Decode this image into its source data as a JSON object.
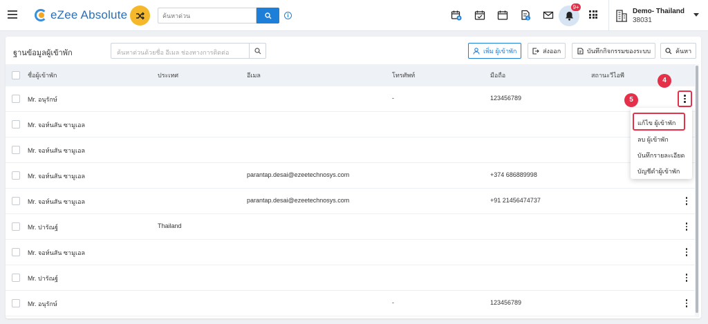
{
  "header": {
    "app_name": "eZee Absolute",
    "search_placeholder": "ค้นหาด่วน",
    "notifications_count": "9+",
    "property": {
      "name": "Demo- Thailand",
      "code": "38031"
    },
    "icons": [
      "menu-icon",
      "shuffle-icon",
      "search-icon",
      "info-icon",
      "calendar-plus-icon",
      "calendar-check-icon",
      "calendar-icon",
      "document-badge-icon",
      "mail-icon",
      "bell-icon",
      "apps-grid-icon",
      "building-icon",
      "chevron-down-icon"
    ]
  },
  "card": {
    "title": "ฐานข้อมูลผู้เข้าพัก",
    "search_placeholder": "ค้นหาด่วนด้วยชื่อ อีเมล ช่องทางการติดต่อ",
    "buttons": {
      "add_guest": "เพิ่ม ผู้เข้าพัก",
      "export": "ส่งออก",
      "audit_log": "บันทึกกิจกรรมของระบบ",
      "search": "ค้นหา"
    }
  },
  "table": {
    "columns": [
      "ชื่อผู้เข้าพัก",
      "ประเทศ",
      "อีเมล",
      "โทรศัพท์",
      "มือถือ",
      "สถานะวีไอพี"
    ],
    "rows": [
      {
        "name": "Mr. อนุรักษ์",
        "country": "",
        "email": "",
        "phone": "-",
        "mobile": "123456789",
        "vip": ""
      },
      {
        "name": "Mr. จอห์นสัน ซามูเอล",
        "country": "",
        "email": "",
        "phone": "",
        "mobile": "",
        "vip": ""
      },
      {
        "name": "Mr. จอห์นสัน ซามูเอล",
        "country": "",
        "email": "",
        "phone": "",
        "mobile": "",
        "vip": ""
      },
      {
        "name": "Mr. จอห์นสัน ซามูเอล",
        "country": "",
        "email": "parantap.desai@ezeetechnosys.com",
        "phone": "",
        "mobile": "+374 686889998",
        "vip": ""
      },
      {
        "name": "Mr. จอห์นสัน ซามูเอล",
        "country": "",
        "email": "parantap.desai@ezeetechnosys.com",
        "phone": "",
        "mobile": "+91 21456474737",
        "vip": ""
      },
      {
        "name": "Mr. ปารัณฐ์",
        "country": "Thailand",
        "email": "",
        "phone": "",
        "mobile": "",
        "vip": ""
      },
      {
        "name": "Mr. จอห์นสัน ซามูเอล",
        "country": "",
        "email": "",
        "phone": "",
        "mobile": "",
        "vip": ""
      },
      {
        "name": "Mr. ปารัณฐ์",
        "country": "",
        "email": "",
        "phone": "",
        "mobile": "",
        "vip": ""
      },
      {
        "name": "Mr. อนุรักษ์",
        "country": "",
        "email": "",
        "phone": "-",
        "mobile": "123456789",
        "vip": ""
      }
    ]
  },
  "row_menu": {
    "items": [
      "แก้ไข ผู้เข้าพัก",
      "ลบ ผู้เข้าพัก",
      "บันทึกรายละเอียด",
      "บัญชีดำผู้เข้าพัก"
    ]
  },
  "annotations": {
    "step_4": "4",
    "step_5": "5"
  },
  "colors": {
    "accent": "#1e7fd8",
    "highlight": "#e5304a",
    "shuffle": "#f5b82a"
  }
}
